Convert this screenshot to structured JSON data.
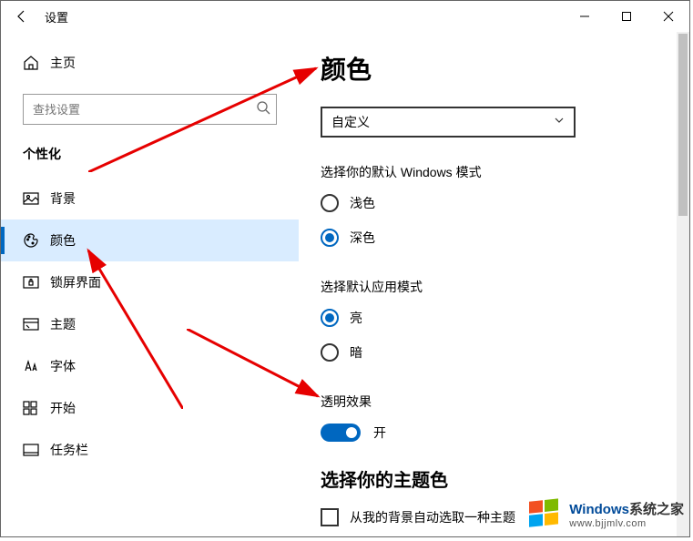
{
  "titlebar": {
    "title": "设置"
  },
  "sidebar": {
    "home_label": "主页",
    "search_placeholder": "查找设置",
    "section_title": "个性化",
    "items": [
      {
        "label": "背景"
      },
      {
        "label": "颜色"
      },
      {
        "label": "锁屏界面"
      },
      {
        "label": "主题"
      },
      {
        "label": "字体"
      },
      {
        "label": "开始"
      },
      {
        "label": "任务栏"
      }
    ],
    "selected_index": 1
  },
  "main": {
    "page_title": "颜色",
    "color_mode_value": "自定义",
    "windows_mode_label": "选择你的默认 Windows 模式",
    "windows_mode_options": [
      {
        "label": "浅色",
        "checked": false
      },
      {
        "label": "深色",
        "checked": true
      }
    ],
    "app_mode_label": "选择默认应用模式",
    "app_mode_options": [
      {
        "label": "亮",
        "checked": true
      },
      {
        "label": "暗",
        "checked": false
      }
    ],
    "transparency_label": "透明效果",
    "transparency_state": "开",
    "accent_heading": "选择你的主题色",
    "auto_pick_label": "从我的背景自动选取一种主题"
  },
  "watermark": {
    "brand_strong": "Windows",
    "brand_rest": "系统之家",
    "url": "www.bjjmlv.com"
  },
  "icons": {
    "back": "back-arrow-icon",
    "home": "home-icon",
    "search": "search-icon",
    "chevron_down": "chevron-down-icon",
    "picture": "picture-icon",
    "palette": "palette-icon",
    "lock": "lock-screen-icon",
    "theme": "theme-icon",
    "font": "font-icon",
    "start": "start-menu-icon",
    "taskbar": "taskbar-icon",
    "minimize": "minimize-icon",
    "maximize": "maximize-icon",
    "close": "close-icon"
  }
}
